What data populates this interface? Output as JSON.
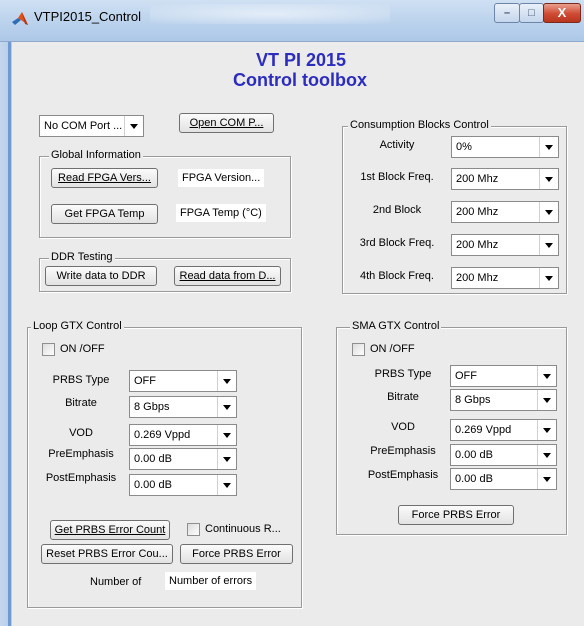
{
  "window": {
    "title": "VTPI2015_Control",
    "minimize_glyph": "–",
    "maximize_glyph": "□",
    "close_glyph": "X",
    "icon": "matlab-logo-icon"
  },
  "header": {
    "title": "VT PI 2015",
    "subtitle": "Control toolbox"
  },
  "com": {
    "port_select": "No COM Port ...",
    "open_button": "Open COM P..."
  },
  "global_info": {
    "group_title": "Global Information",
    "read_version_button": "Read FPGA Vers...",
    "version_readout": "FPGA Version...",
    "get_temp_button": "Get FPGA Temp",
    "temp_readout": "FPGA Temp (°C)"
  },
  "ddr": {
    "group_title": "DDR Testing",
    "write_button": "Write data to DDR",
    "read_button": "Read data from D..."
  },
  "consumption": {
    "group_title": "Consumption Blocks Control",
    "rows": [
      {
        "label": "Activity",
        "value": "0%"
      },
      {
        "label": "1st Block Freq.",
        "value": "200 Mhz"
      },
      {
        "label": "2nd Block",
        "value": "200 Mhz"
      },
      {
        "label": "3rd Block Freq.",
        "value": "200 Mhz"
      },
      {
        "label": "4th Block Freq.",
        "value": "200 Mhz"
      }
    ]
  },
  "loop_gtx": {
    "group_title": "Loop GTX Control",
    "onoff_label": "ON /OFF",
    "rows": [
      {
        "label": "PRBS Type",
        "value": "OFF"
      },
      {
        "label": "Bitrate",
        "value": "8 Gbps"
      },
      {
        "label": "VOD",
        "value": "0.269 Vppd"
      },
      {
        "label": "PreEmphasis",
        "value": "0.00 dB"
      },
      {
        "label": "PostEmphasis",
        "value": "0.00 dB"
      }
    ],
    "get_prbs_button": "Get PRBS Error Count",
    "continuous_label": "Continuous R...",
    "reset_prbs_button": "Reset PRBS Error Cou...",
    "force_prbs_button": "Force PRBS Error",
    "number_of_label": "Number of",
    "errors_readout": "Number of errors"
  },
  "sma_gtx": {
    "group_title": "SMA GTX Control",
    "onoff_label": "ON /OFF",
    "rows": [
      {
        "label": "PRBS Type",
        "value": "OFF"
      },
      {
        "label": "Bitrate",
        "value": "8 Gbps"
      },
      {
        "label": "VOD",
        "value": "0.269 Vppd"
      },
      {
        "label": "PreEmphasis",
        "value": "0.00 dB"
      },
      {
        "label": "PostEmphasis",
        "value": "0.00 dB"
      }
    ],
    "force_prbs_button": "Force PRBS Error"
  }
}
